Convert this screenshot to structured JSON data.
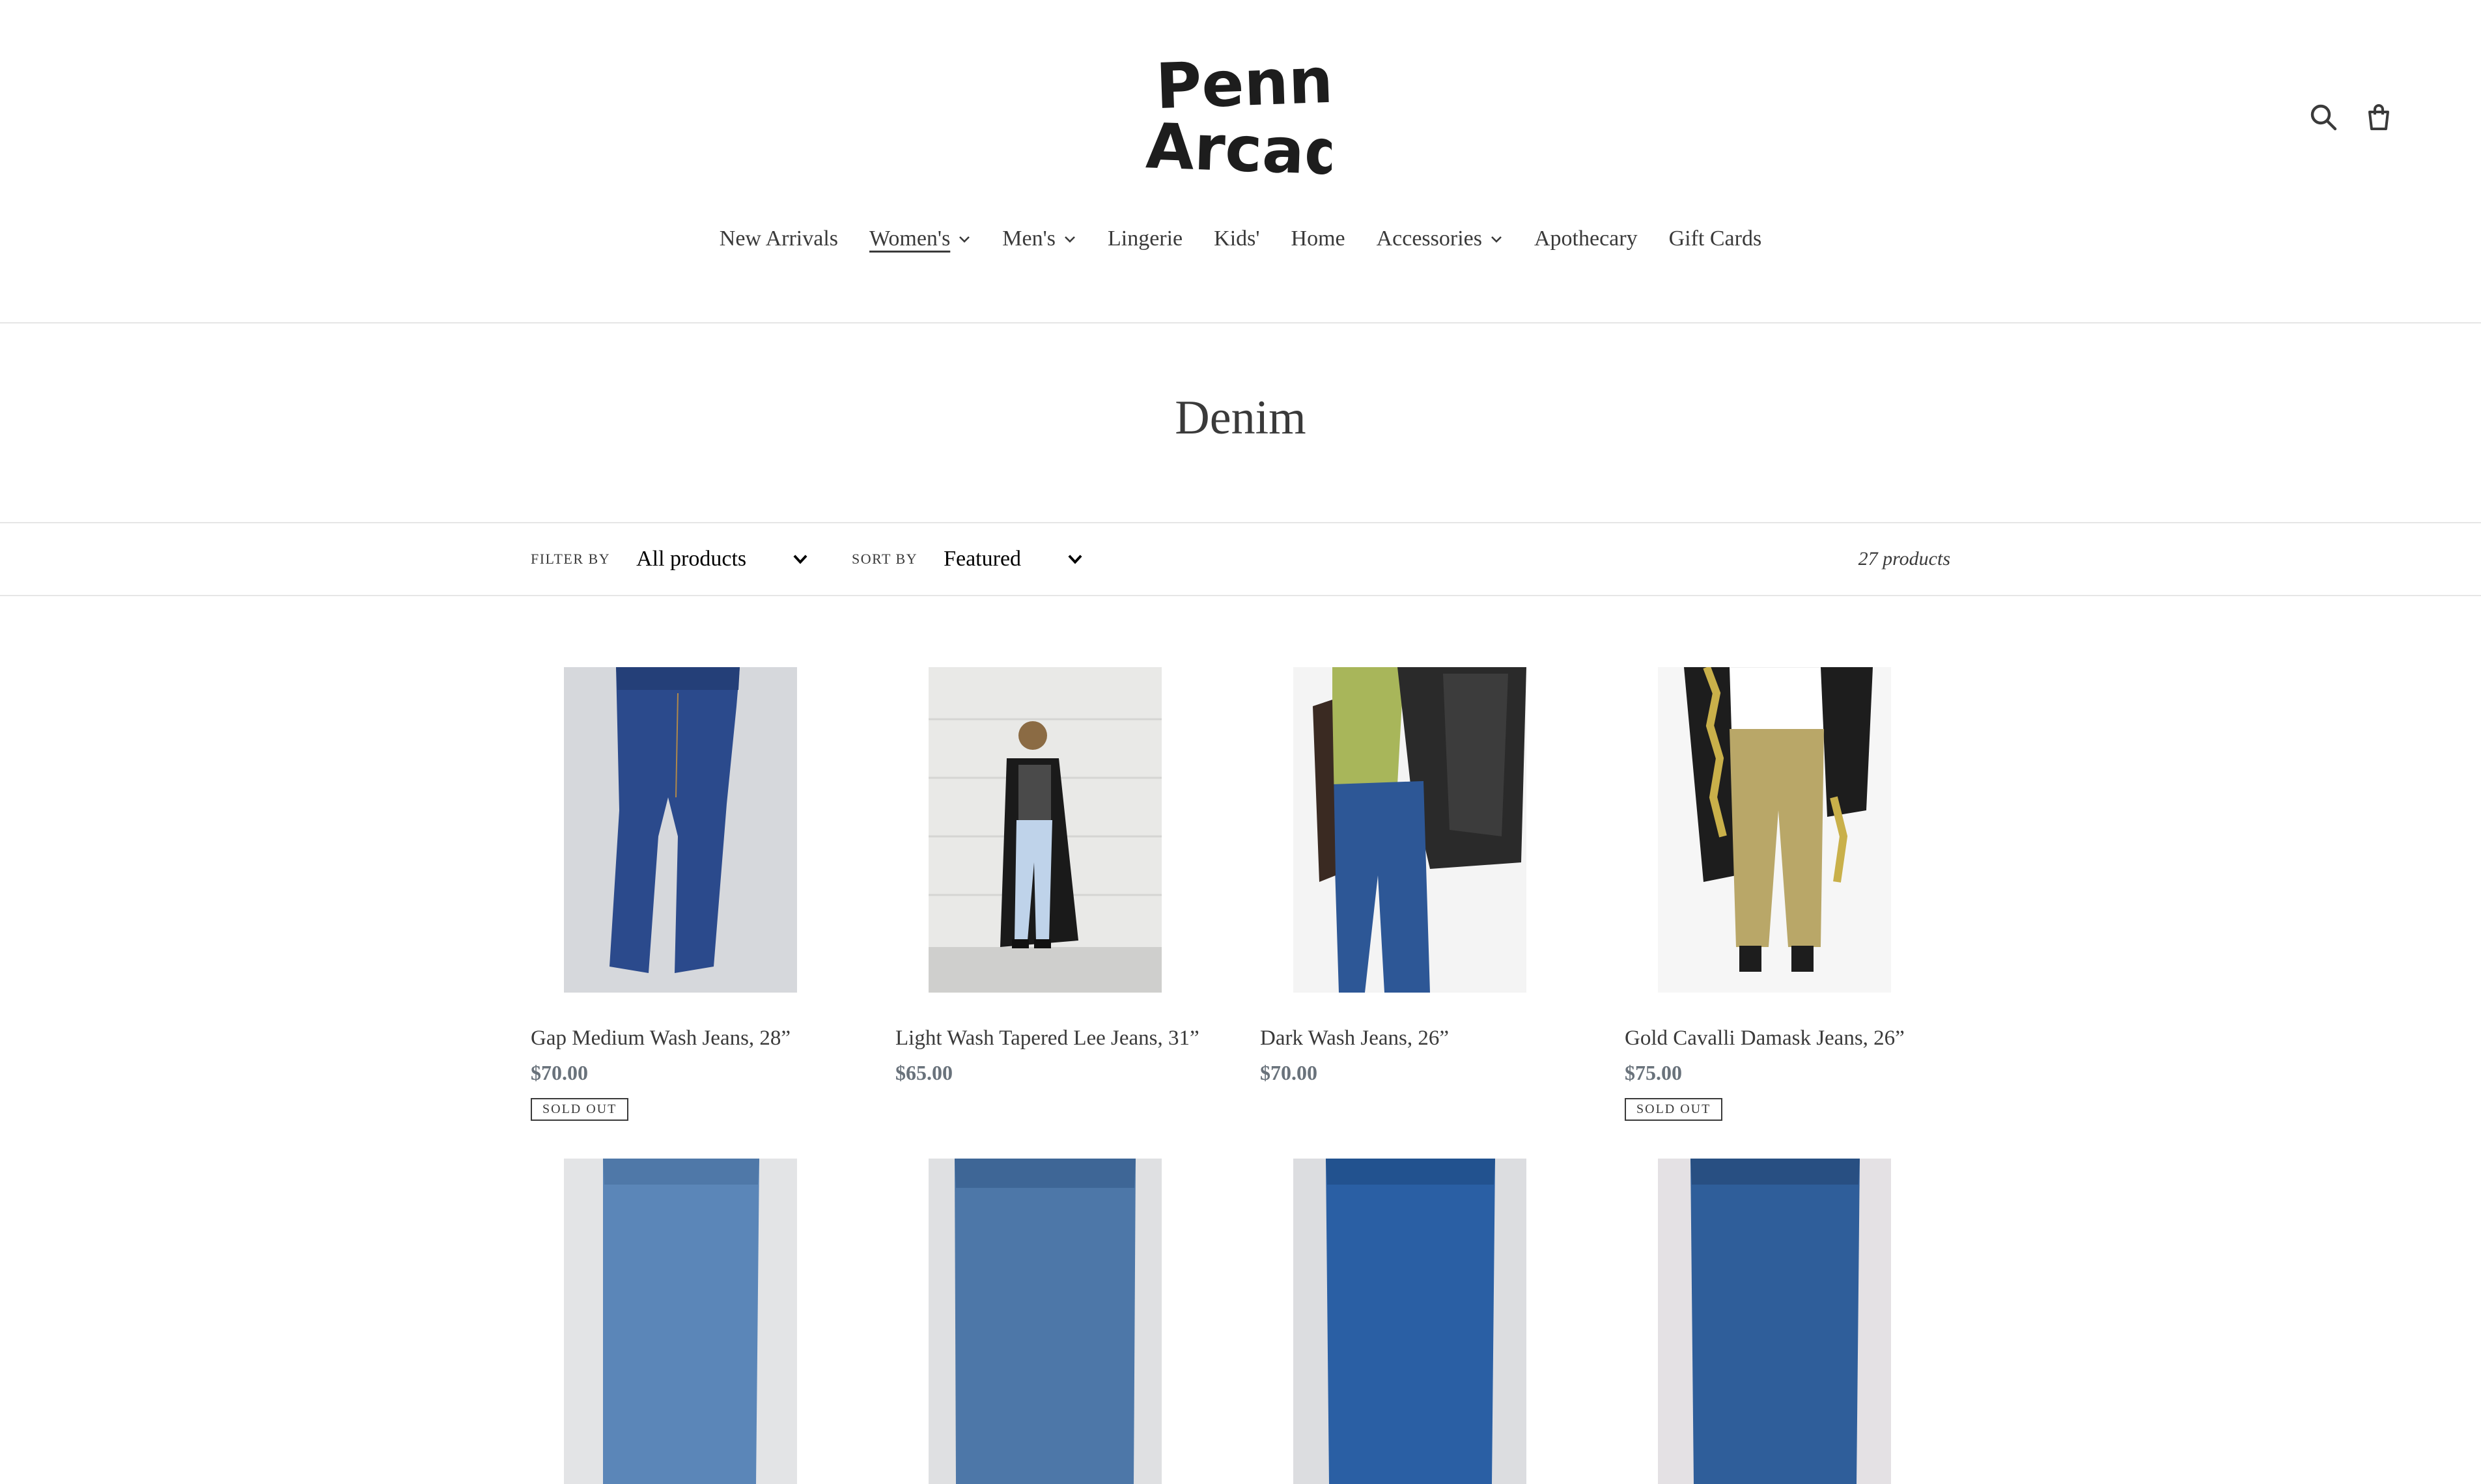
{
  "logo": {
    "line1": "Penny",
    "line2": "Arcade"
  },
  "header": {
    "search_icon": "search-icon",
    "cart_icon": "cart-icon"
  },
  "nav": [
    {
      "label": "New Arrivals",
      "has_dropdown": false,
      "active": false
    },
    {
      "label": "Women's",
      "has_dropdown": true,
      "active": true
    },
    {
      "label": "Men's",
      "has_dropdown": true,
      "active": false
    },
    {
      "label": "Lingerie",
      "has_dropdown": false,
      "active": false
    },
    {
      "label": "Kids'",
      "has_dropdown": false,
      "active": false
    },
    {
      "label": "Home",
      "has_dropdown": false,
      "active": false
    },
    {
      "label": "Accessories",
      "has_dropdown": true,
      "active": false
    },
    {
      "label": "Apothecary",
      "has_dropdown": false,
      "active": false
    },
    {
      "label": "Gift Cards",
      "has_dropdown": false,
      "active": false
    }
  ],
  "collection": {
    "title": "Denim"
  },
  "filters": {
    "filter_label": "Filter by",
    "filter_value": "All products",
    "sort_label": "Sort by",
    "sort_value": "Featured",
    "product_count": "27 products"
  },
  "products": [
    {
      "title": "Gap Medium Wash Jeans, 28”",
      "price": "$70.00",
      "sold_out": true,
      "badge": "Sold out",
      "image": "medium-wash-jeans-flatlay"
    },
    {
      "title": "Light Wash Tapered Lee Jeans, 31”",
      "price": "$65.00",
      "sold_out": false,
      "badge": "",
      "image": "model-light-wash-jeans"
    },
    {
      "title": "Dark Wash Jeans, 26”",
      "price": "$70.00",
      "sold_out": false,
      "badge": "",
      "image": "model-dark-wash-jeans"
    },
    {
      "title": "Gold Cavalli Damask Jeans, 26”",
      "price": "$75.00",
      "sold_out": true,
      "badge": "Sold out",
      "image": "model-gold-jeans"
    },
    {
      "title": "",
      "price": "",
      "sold_out": false,
      "badge": "",
      "image": "medium-light-wash-jeans-flatlay"
    },
    {
      "title": "",
      "price": "",
      "sold_out": false,
      "badge": "",
      "image": "medium-wash-jeans-flatlay-2"
    },
    {
      "title": "",
      "price": "",
      "sold_out": false,
      "badge": "",
      "image": "dark-wash-jeans-flatlay"
    },
    {
      "title": "",
      "price": "",
      "sold_out": false,
      "badge": "",
      "image": "dark-wash-jeans-flatlay-2"
    }
  ],
  "colors": {
    "text": "#3a3a3a",
    "price": "#69727b",
    "border": "#e6e6e6"
  }
}
